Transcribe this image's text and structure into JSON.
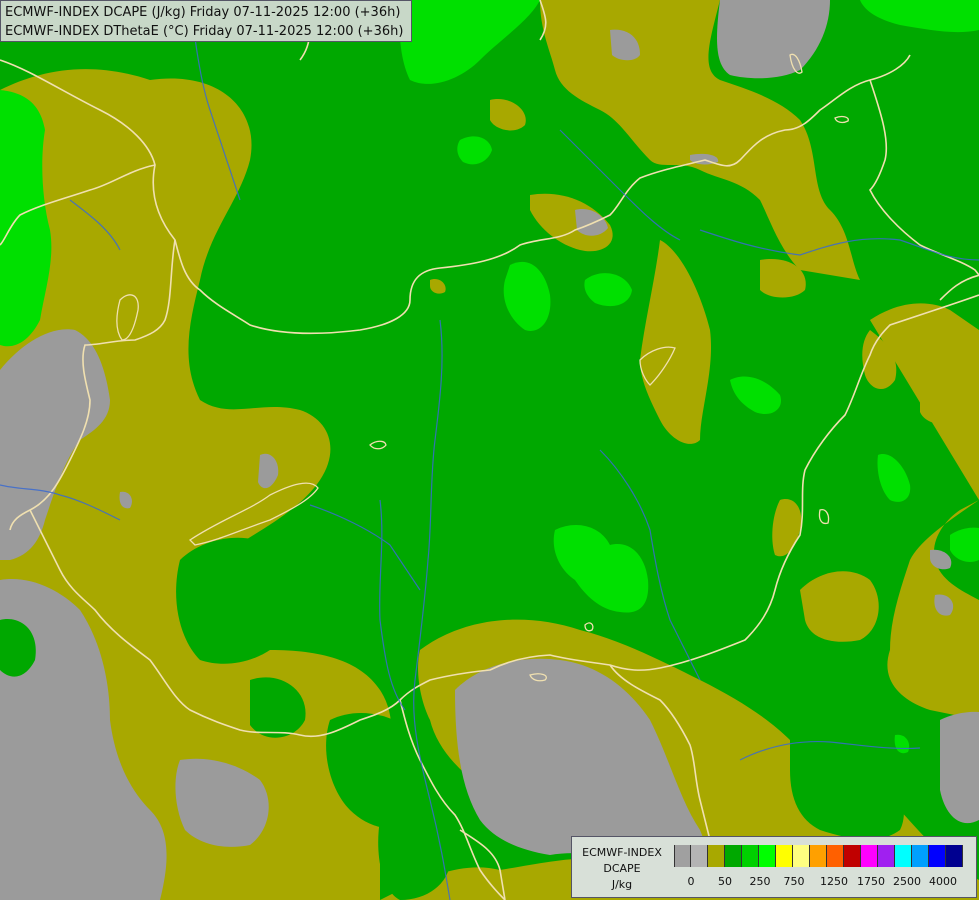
{
  "header": {
    "line1": "ECMWF-INDEX DCAPE (J/kg) Friday 07-11-2025 12:00 (+36h)",
    "line2": "ECMWF-INDEX DThetaE (°C) Friday 07-11-2025 12:00 (+36h)"
  },
  "legend": {
    "title_line1": "ECMWF-INDEX",
    "title_line2": "DCAPE",
    "title_line3": "J/kg",
    "colors": [
      "#a0a0a0",
      "#b4b4b4",
      "#a8a800",
      "#00a800",
      "#00d000",
      "#00ff00",
      "#ffff00",
      "#ffff80",
      "#ffa000",
      "#ff6000",
      "#c00000",
      "#ff00ff",
      "#a020f0",
      "#00ffff",
      "#00a0ff",
      "#0000ff",
      "#000090"
    ],
    "tick_labels": [
      "0",
      "50",
      "250",
      "750",
      "1250",
      "1750",
      "2500",
      "4000"
    ]
  },
  "map_colors": {
    "gray": "#9b9b9b",
    "olive": "#a8a800",
    "green": "#00a800",
    "light_green": "#00e000",
    "border": "#f0e0b0",
    "river": "#3a6ad0"
  }
}
